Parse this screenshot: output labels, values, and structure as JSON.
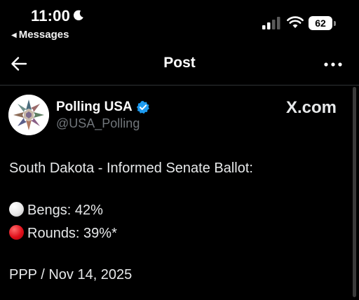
{
  "status_bar": {
    "time": "11:00",
    "back_app_label": "Messages",
    "battery_percent": "62",
    "icons": [
      "moon-icon",
      "cellular-signal-icon",
      "wifi-icon",
      "battery-icon"
    ]
  },
  "nav": {
    "title": "Post",
    "icons": [
      "back-arrow-icon",
      "more-options-icon"
    ]
  },
  "post": {
    "author": {
      "display_name": "Polling USA",
      "handle": "@USA_Polling",
      "verified": true,
      "verified_color": "#1d9bf0"
    },
    "source_label": "X.com",
    "lines": [
      "South Dakota - Informed Senate Ballot:",
      "Bengs: 42%",
      "Rounds: 39%*",
      "PPP / Nov 14, 2025"
    ],
    "candidate_dots": [
      {
        "candidate": "Bengs",
        "color": "#e8e8e8"
      },
      {
        "candidate": "Rounds",
        "color": "#e0101b"
      }
    ]
  },
  "colors": {
    "background": "#000000",
    "text": "#e7e9ea",
    "secondary_text": "#71767b",
    "divider": "#2f3336"
  }
}
